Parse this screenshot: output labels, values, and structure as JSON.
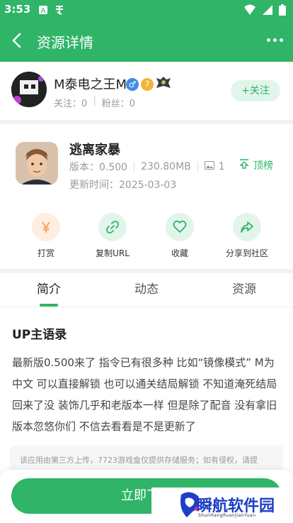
{
  "status_bar": {
    "time": "3:53"
  },
  "app_bar": {
    "title": "资源详情"
  },
  "user": {
    "name": "M泰电之王M",
    "level_badge": "7",
    "follow_label": "关注",
    "follow_count": "0",
    "fans_label": "粉丝",
    "fans_count": "0",
    "follow_button": "+关注"
  },
  "app": {
    "name": "逃离家暴",
    "version": "版本：0.500",
    "size": "230.80MB",
    "image_count": "1",
    "update_time": "更新时间：2025-03-03",
    "top_label": "顶榜"
  },
  "actions": [
    {
      "label": "打赏",
      "icon": "yen-icon",
      "color": "#f5a05a",
      "bg": "#fdeee0"
    },
    {
      "label": "复制URL",
      "icon": "link-icon",
      "color": "#2fb468",
      "bg": "#e2f5ea"
    },
    {
      "label": "收藏",
      "icon": "heart-icon",
      "color": "#2fb468",
      "bg": "#e2f5ea"
    },
    {
      "label": "分享到社区",
      "icon": "share-icon",
      "color": "#2fb468",
      "bg": "#e2f5ea"
    }
  ],
  "tabs": [
    {
      "label": "简介",
      "active": true
    },
    {
      "label": "动态",
      "active": false
    },
    {
      "label": "资源",
      "active": false
    }
  ],
  "intro": {
    "title": "UP主语录",
    "body": "最新版0.500来了 指令已有很多种 比如“镜像模式” M为中文 可以直接解锁 也可以通关结局解锁 不知道淹死结局回来了没 装饰几乎和老版本一样 但是除了配音 没有拿旧版本忽悠你们 不信去看看是不是更新了"
  },
  "notice": "该应用由第三方上传，7723游戏盒仅提供存储服务；如有侵权，请提",
  "download_button": "立即下载",
  "watermark": {
    "text": "瞬航软件园",
    "sub": "ShunHangRuanJianYuan"
  },
  "colors": {
    "accent": "#2fb468",
    "accent_light": "#e2f5ea"
  }
}
